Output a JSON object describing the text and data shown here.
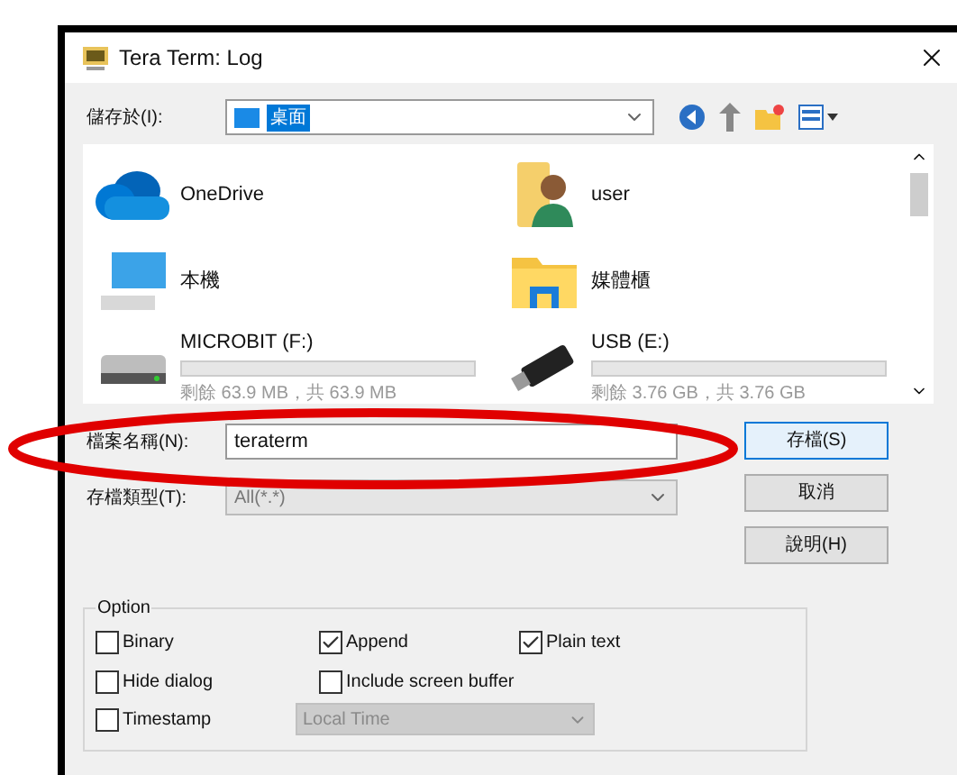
{
  "window": {
    "title": "Tera Term: Log"
  },
  "location": {
    "label": "儲存於(I):",
    "value": "桌面"
  },
  "places": [
    {
      "kind": "onedrive",
      "name": "OneDrive"
    },
    {
      "kind": "user",
      "name": "user"
    },
    {
      "kind": "computer",
      "name": "本機"
    },
    {
      "kind": "library",
      "name": "媒體櫃"
    },
    {
      "kind": "drive",
      "name": "MICROBIT (F:)",
      "level": 0,
      "space": "剩餘 63.9 MB，共 63.9 MB"
    },
    {
      "kind": "usb",
      "name": "USB (E:)",
      "level": 0,
      "space": "剩餘 3.76 GB，共 3.76 GB"
    }
  ],
  "filename": {
    "label": "檔案名稱(N):",
    "value": "teraterm"
  },
  "filetype": {
    "label": "存檔類型(T):",
    "value": "All(*.*)"
  },
  "buttons": [
    {
      "label": "存檔(S)",
      "default": true
    },
    {
      "label": "取消",
      "default": false
    },
    {
      "label": "說明(H)",
      "default": false
    }
  ],
  "option": {
    "title": "Option",
    "checkboxes": [
      {
        "label": "Binary",
        "checked": false
      },
      {
        "label": "Append",
        "checked": true
      },
      {
        "label": "Plain text",
        "checked": true
      },
      {
        "label": "Hide dialog",
        "checked": false
      },
      {
        "label": "Include screen buffer",
        "checked": false
      }
    ],
    "timestamp": {
      "label": "Timestamp",
      "checked": false
    },
    "timezone": {
      "value": "Local Time",
      "disabled": true
    }
  }
}
